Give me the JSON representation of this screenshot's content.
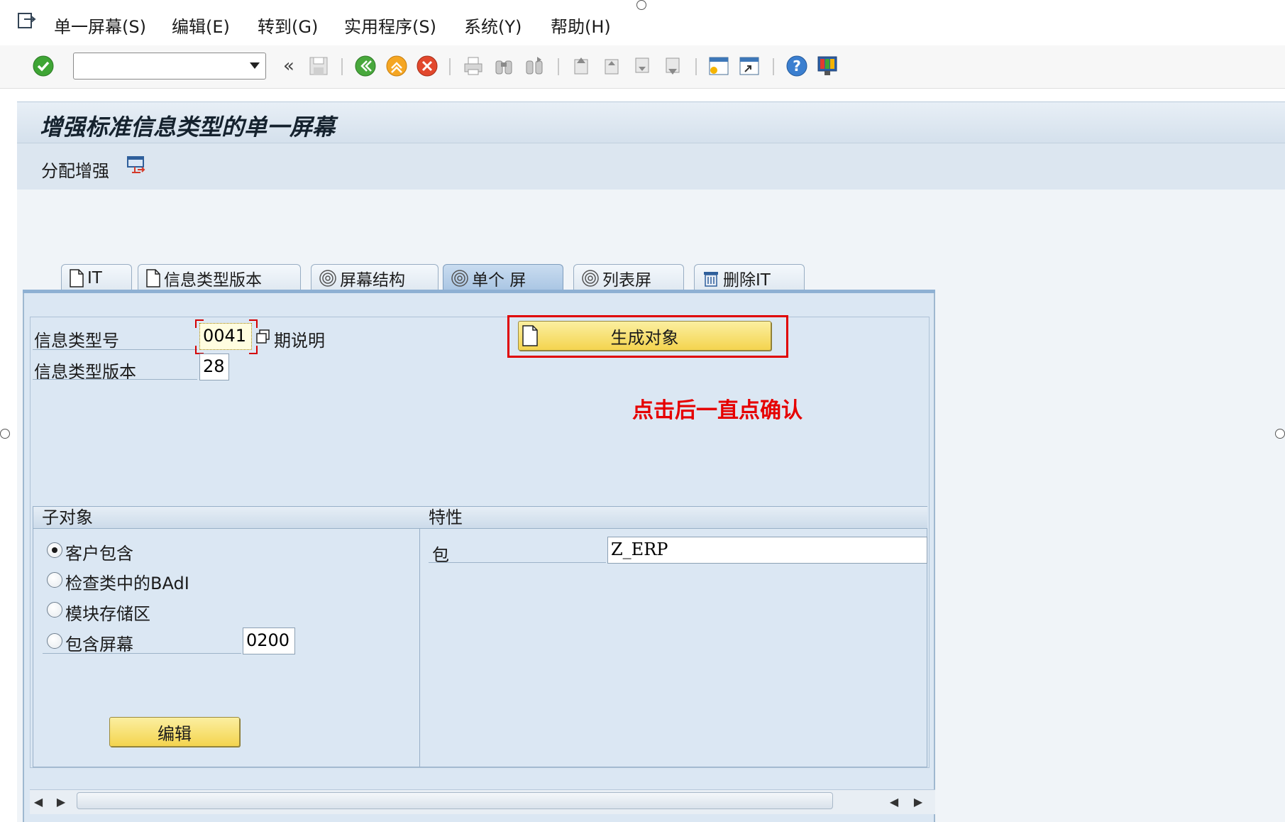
{
  "menu": {
    "items": [
      "单一屏幕(S)",
      "编辑(E)",
      "转到(G)",
      "实用程序(S)",
      "系统(Y)",
      "帮助(H)"
    ]
  },
  "toolbar": {
    "command_value": "",
    "icons": [
      "enter-icon",
      "back-icon",
      "exit-icon",
      "cancel-icon",
      "print-icon",
      "find-icon",
      "find-next-icon",
      "first-page-icon",
      "prev-page-icon",
      "next-page-icon",
      "last-page-icon",
      "new-session-icon",
      "shortcut-icon",
      "help-icon",
      "customize-layout-icon"
    ]
  },
  "title": "增强标准信息类型的单一屏幕",
  "app_toolbar": {
    "assign_label": "分配增强"
  },
  "tabs": [
    {
      "label": "IT",
      "icon": "document-icon"
    },
    {
      "label": "信息类型版本",
      "icon": "document-icon"
    },
    {
      "label": "屏幕结构",
      "icon": "spiral-icon"
    },
    {
      "label": "单个 屏",
      "icon": "spiral-icon",
      "active": true
    },
    {
      "label": "列表屏",
      "icon": "spiral-icon"
    },
    {
      "label": "删除IT",
      "icon": "trash-icon"
    }
  ],
  "form": {
    "infotype_label": "信息类型号",
    "infotype_value": "0041",
    "infotype_desc": "期说明",
    "version_label": "信息类型版本",
    "version_value": "28",
    "generate_button": "生成对象"
  },
  "annotation": "点击后一直点确认",
  "subobjects": {
    "header": "子对象",
    "options": [
      {
        "label": "客户包含",
        "selected": true
      },
      {
        "label": "检查类中的BAdI",
        "selected": false
      },
      {
        "label": "模块存储区",
        "selected": false
      },
      {
        "label": "包含屏幕",
        "selected": false
      }
    ],
    "include_screen_value": "0200",
    "edit_button": "编辑"
  },
  "attributes": {
    "header": "特性",
    "package_label": "包",
    "package_value": "Z_ERP"
  },
  "colors": {
    "accent": "#8eb0d3",
    "annotation": "#e60000",
    "button": "#f4d44f"
  }
}
